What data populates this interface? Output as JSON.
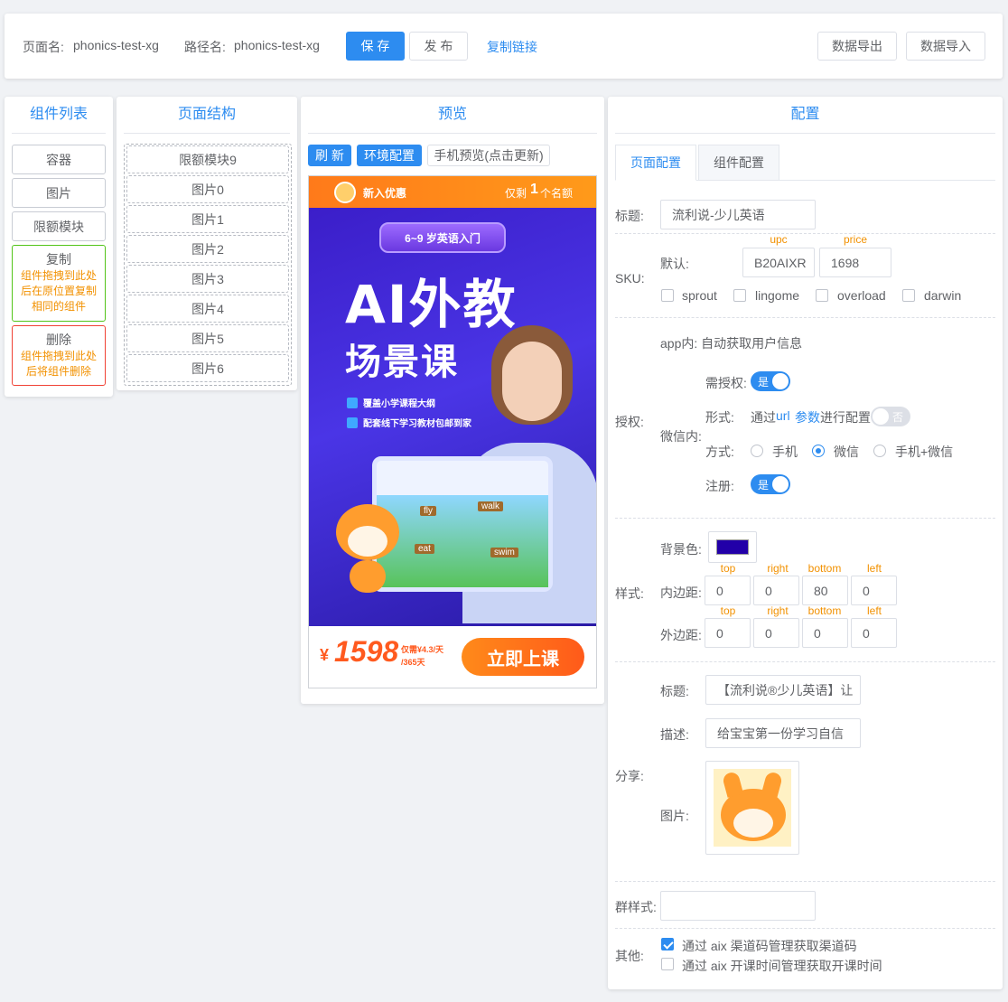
{
  "topbar": {
    "page_name_label": "页面名:",
    "page_name": "phonics-test-xg",
    "path_label": "路径名:",
    "path_name": "phonics-test-xg",
    "save": "保 存",
    "publish": "发 布",
    "copy_link": "复制链接",
    "export": "数据导出",
    "import": "数据导入"
  },
  "components_panel": {
    "title": "组件列表",
    "items": [
      "容器",
      "图片",
      "限额模块"
    ],
    "copy": {
      "title": "复制",
      "desc": "组件拖拽到此处后在原位置复制相同的组件"
    },
    "delete": {
      "title": "删除",
      "desc": "组件拖拽到此处后将组件删除"
    }
  },
  "structure_panel": {
    "title": "页面结构",
    "items": [
      "限额模块9",
      "图片0",
      "图片1",
      "图片2",
      "图片3",
      "图片4",
      "图片5",
      "图片6"
    ]
  },
  "preview_panel": {
    "title": "预览",
    "refresh": "刷 新",
    "env_config": "环境配置",
    "mobile_preview": "手机预览(点击更新)",
    "banner": {
      "badge_text": "新入优惠",
      "remain_prefix": "仅剩",
      "remain_count": "1",
      "remain_suffix": "个名额",
      "age_tag": "6~9 岁英语入门",
      "headline1": "AI外教",
      "headline2": "场景课",
      "bullet1": "覆盖小学课程大纲",
      "bullet2": "配套线下学习教材包邮到家",
      "word1": "fly",
      "word2": "walk",
      "word3": "eat",
      "word4": "swim",
      "price_symbol": "¥",
      "price": "1598",
      "price_note1": "仅需¥4.3/天",
      "price_note2": "/365天",
      "cta": "立即上课"
    }
  },
  "config_panel": {
    "title": "配置",
    "tabs": [
      "页面配置",
      "组件配置"
    ],
    "title_label": "标题:",
    "title_value": "流利说-少儿英语",
    "sku_label": "SKU:",
    "sku_default_label": "默认:",
    "upc_label": "upc",
    "price_label": "price",
    "upc_value": "B20AIXR",
    "price_value": "1698",
    "sku_options": [
      "sprout",
      "lingome",
      "overload",
      "darwin"
    ],
    "auth_label": "授权:",
    "app_text": "app内: 自动获取用户信息",
    "wechat_label": "微信内:",
    "need_auth_label": "需授权:",
    "switch_yes": "是",
    "switch_no": "否",
    "form_label": "形式:",
    "form_text_pre": "通过",
    "form_link1": "url",
    "form_link2": "参数",
    "form_text_post": "进行配置",
    "method_label": "方式:",
    "methods": [
      "手机",
      "微信",
      "手机+微信"
    ],
    "register_label": "注册:",
    "style_label": "样式:",
    "bg_label": "背景色:",
    "bg_color": "#2200a8",
    "padding_label": "内边距:",
    "margin_label": "外边距:",
    "sides": [
      "top",
      "right",
      "bottom",
      "left"
    ],
    "padding_values": [
      "0",
      "0",
      "80",
      "0"
    ],
    "margin_values": [
      "0",
      "0",
      "0",
      "0"
    ],
    "share_label": "分享:",
    "share_title_label": "标题:",
    "share_title_value": "【流利说®少儿英语】让",
    "share_desc_label": "描述:",
    "share_desc_value": "给宝宝第一份学习自信",
    "share_image_label": "图片:",
    "group_style_label": "群样式:",
    "group_style_value": "",
    "other_label": "其他:",
    "other_options": [
      "通过 aix 渠道码管理获取渠道码",
      "通过 aix 开课时间管理获取开课时间"
    ]
  }
}
